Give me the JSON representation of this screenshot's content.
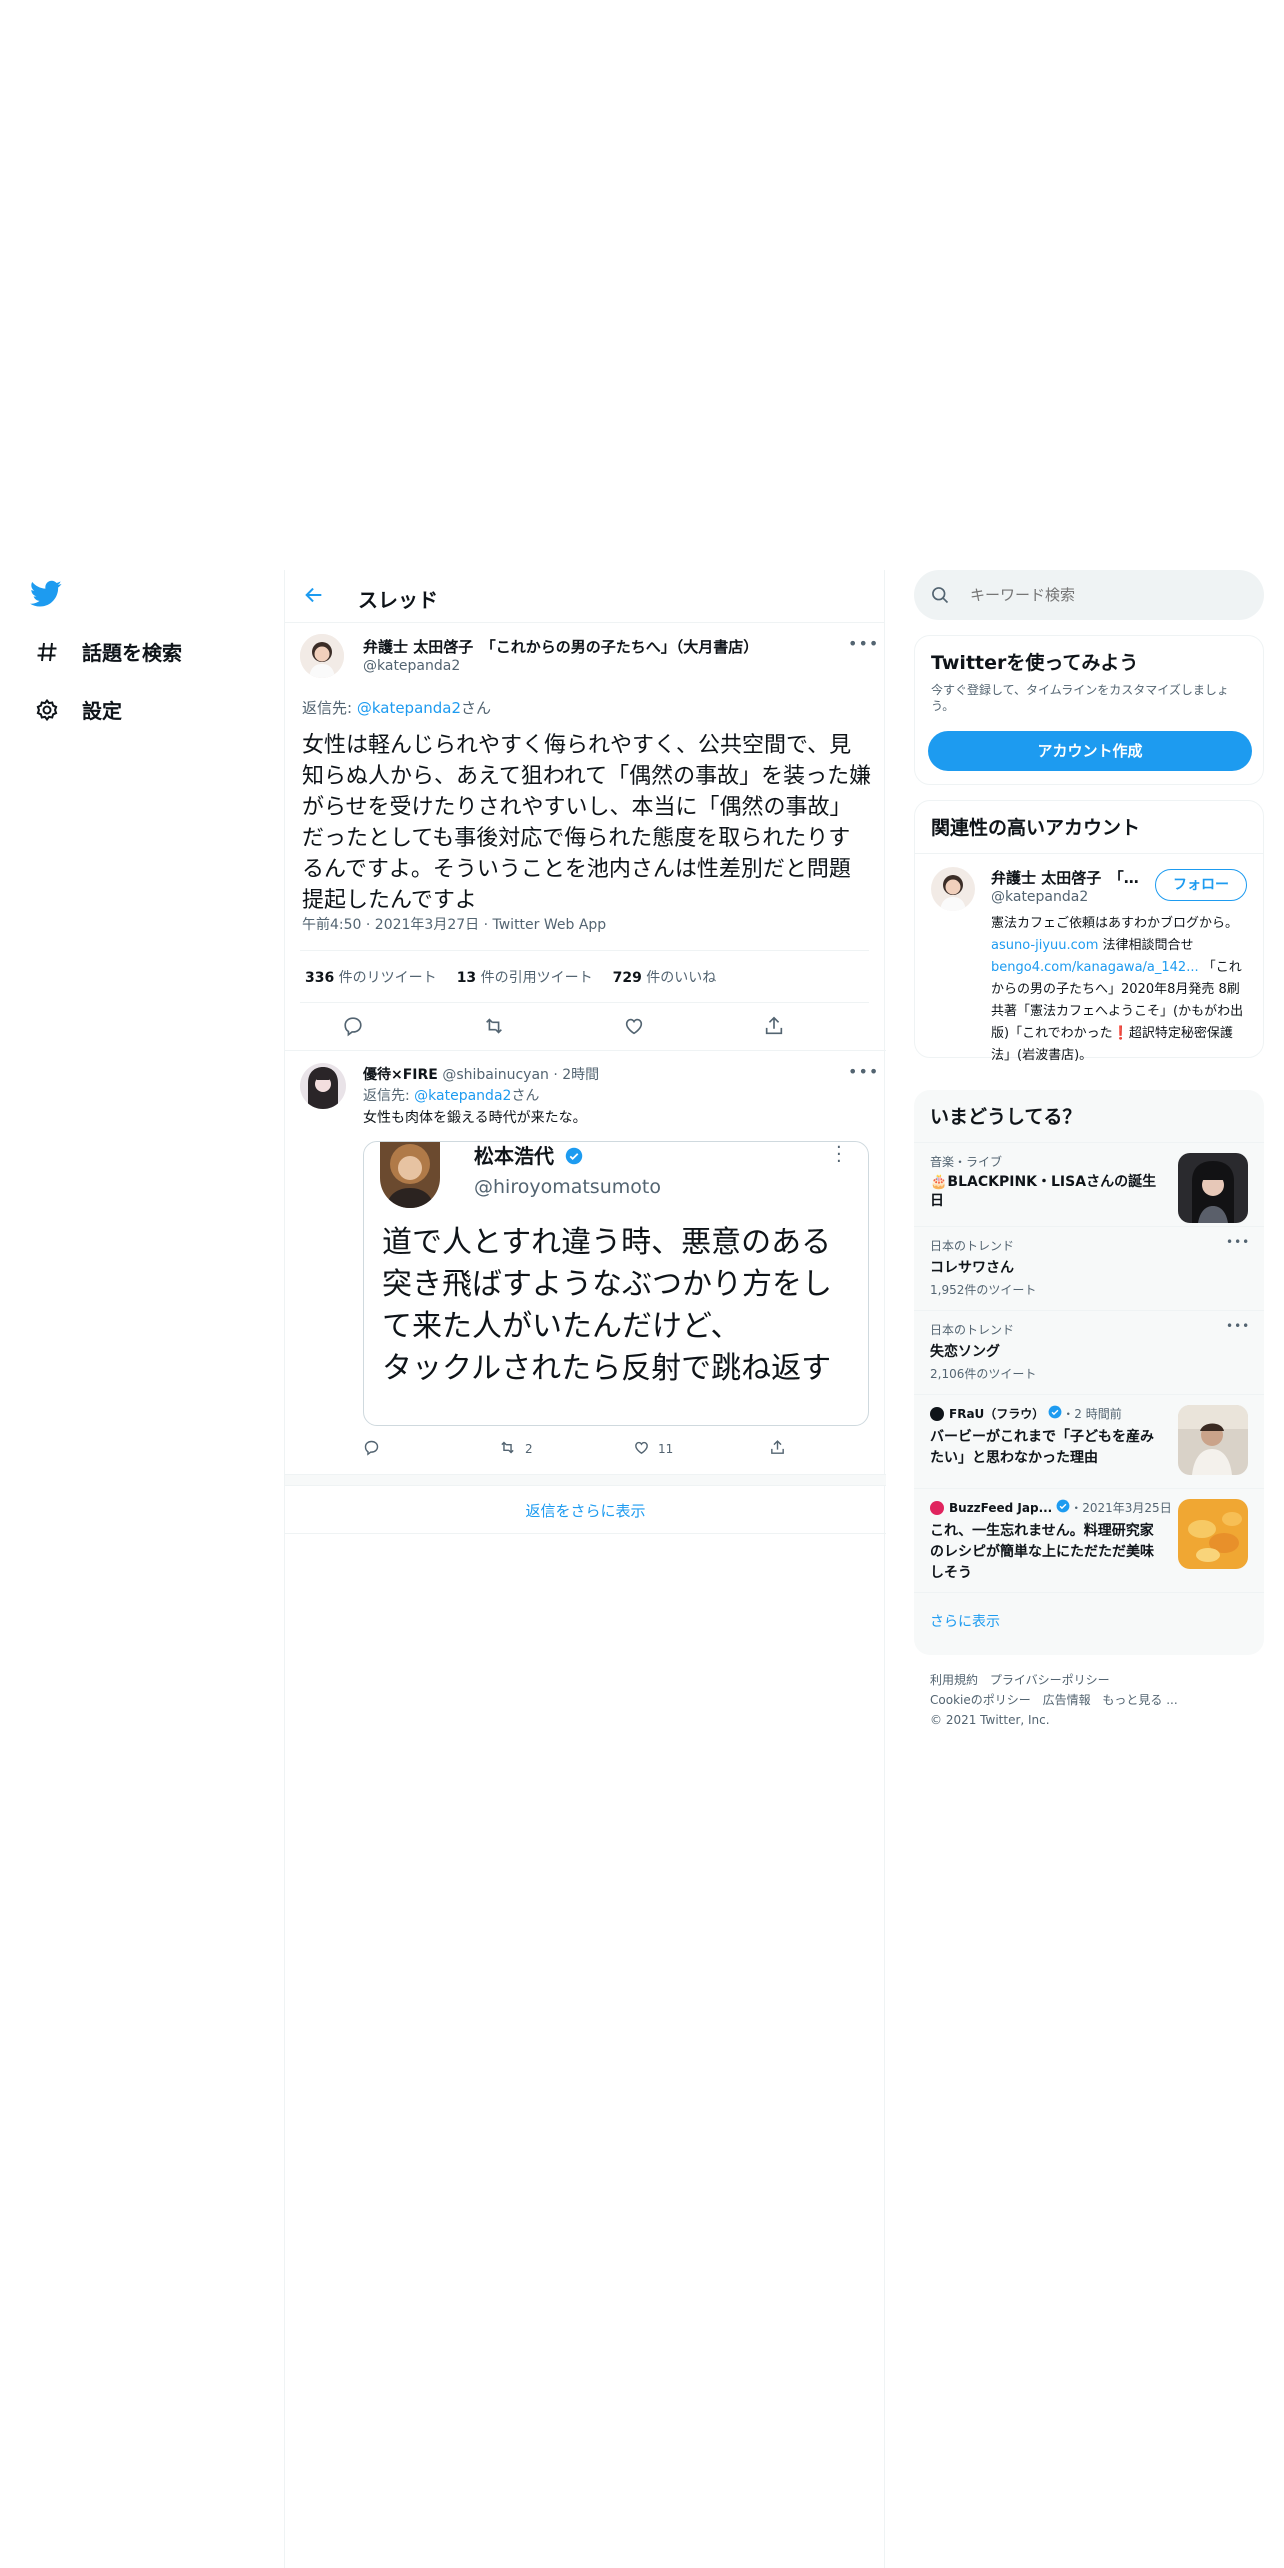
{
  "nav": {
    "explore": "話題を検索",
    "settings": "設定"
  },
  "header": {
    "title": "スレッド"
  },
  "main_tweet": {
    "name": "弁護士 太田啓子　「これからの男の子たちへ」（大月書店）",
    "handle": "@katepanda2",
    "reply_prefix": "返信先: ",
    "reply_to": "@katepanda2",
    "reply_suffix": "さん",
    "text": "女性は軽んじられやすく侮られやすく、公共空間で、見知らぬ人から、あえて狙われて「偶然の事故」を装った嫌がらせを受けたりされやすいし、本当に「偶然の事故」だったとしても事後対応で侮られた態度を取られたりするんですよ。そういうことを池内さんは性差別だと問題提起したんですよ",
    "meta": "午前4:50 · 2021年3月27日 · Twitter Web App",
    "retweets_count": "336",
    "retweets_label": " 件のリツイート",
    "quotes_count": "13",
    "quotes_label": " 件の引用ツイート",
    "likes_count": "729",
    "likes_label": " 件のいいね"
  },
  "reply_tweet": {
    "name": "優待×FIRE",
    "handle_time": "@shibainucyan · 2時間",
    "reply_prefix": "返信先: ",
    "reply_to": "@katepanda2",
    "reply_suffix": "さん",
    "text": "女性も肉体を鍛える時代が来たな。",
    "retweets": "2",
    "likes": "11",
    "embed": {
      "name": "松本浩代",
      "handle": "@hiroyomatsumoto",
      "line1": "道で人とすれ違う時、悪意のある",
      "line2": "突き飛ばすようなぶつかり方をし",
      "line3": "て来た人がいたんだけど、",
      "line4": "タックルされたら反射で跳ね返す"
    }
  },
  "show_more_replies": "返信をさらに表示",
  "search": {
    "placeholder": "キーワード検索"
  },
  "signup": {
    "title": "Twitterを使ってみよう",
    "desc": "今すぐ登録して、タイムラインをカスタマイズしましょう。",
    "button": "アカウント作成"
  },
  "relevant": {
    "title": "関連性の高いアカウント",
    "name": "弁護士 太田啓子　「…",
    "handle": "@katepanda2",
    "follow": "フォロー",
    "bio1": "憲法カフェご依頼はあすわかブログから。",
    "bio_link1": "asuno-jiyuu.com",
    "bio2": " 法律相談問合せ",
    "bio_link2": "bengo4.com/kanagawa/a_142...",
    "bio3": " 「これからの男の子たちへ」2020年8月発売 8刷 共著「憲法カフェへようこそ」(かもがわ出版)「これでわかった❗️超訳特定秘密保護法」(岩波書店)。"
  },
  "trends": {
    "title": "いまどうしてる？",
    "items": [
      {
        "category": "音楽・ライブ",
        "name": "🎂BLACKPINK・LISAさんの誕生日"
      },
      {
        "category": "日本のトレンド",
        "name": "コレサワさん",
        "count": "1,952件のツイート"
      },
      {
        "category": "日本のトレンド",
        "name": "失恋ソング",
        "count": "2,106件のツイート"
      },
      {
        "source": "FRaU（フラウ）",
        "time": "・2 時間前",
        "name": "バービーがこれまで「子どもを産みたい」と思わなかった理由"
      },
      {
        "source": "BuzzFeed Jap...",
        "time": "・2021年3月25日",
        "name": "これ、一生忘れません。料理研究家のレシピが簡単な上にただただ美味しそう"
      }
    ],
    "show_more": "さらに表示"
  },
  "footer": {
    "terms": "利用規約",
    "privacy": "プライバシーポリシー",
    "cookie": "Cookieのポリシー",
    "ads": "広告情報",
    "more": "もっと見る ...",
    "copyright": "© 2021 Twitter, Inc."
  },
  "colors": {
    "accent": "#1d9bf0",
    "verified": "#1d9bf0"
  }
}
